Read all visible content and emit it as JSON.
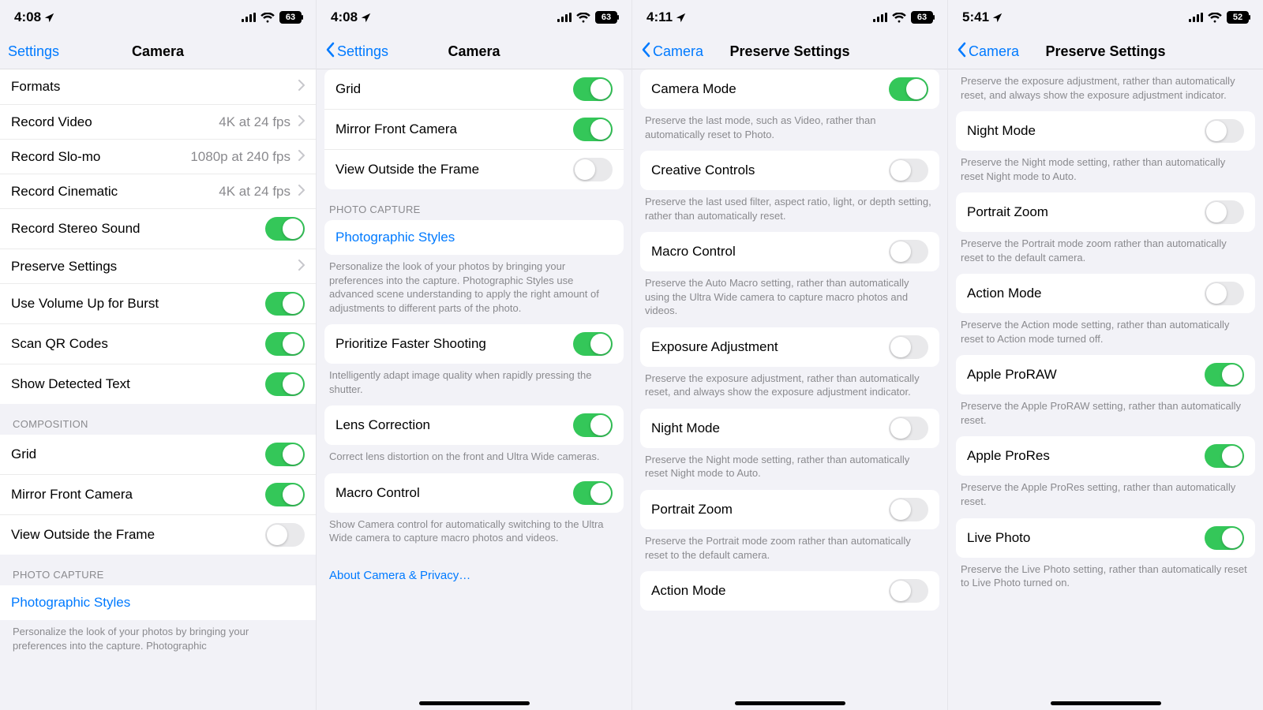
{
  "screens": [
    {
      "statusbar": {
        "time": "4:08",
        "battery": "63"
      },
      "nav": {
        "back": "Settings",
        "title": "Camera",
        "chevron": false
      },
      "footer_link": null,
      "home_indicator": false,
      "blocks": [
        {
          "type": "group",
          "flat": true,
          "rows": [
            {
              "label": "Formats",
              "kind": "nav"
            },
            {
              "label": "Record Video",
              "kind": "nav",
              "value": "4K at 24 fps"
            },
            {
              "label": "Record Slo-mo",
              "kind": "nav",
              "value": "1080p at 240 fps"
            },
            {
              "label": "Record Cinematic",
              "kind": "nav",
              "value": "4K at 24 fps"
            },
            {
              "label": "Record Stereo Sound",
              "kind": "toggle",
              "on": true
            },
            {
              "label": "Preserve Settings",
              "kind": "nav"
            },
            {
              "label": "Use Volume Up for Burst",
              "kind": "toggle",
              "on": true
            },
            {
              "label": "Scan QR Codes",
              "kind": "toggle",
              "on": true
            },
            {
              "label": "Show Detected Text",
              "kind": "toggle",
              "on": true
            }
          ]
        },
        {
          "type": "header",
          "text": "COMPOSITION"
        },
        {
          "type": "group",
          "flat": true,
          "rows": [
            {
              "label": "Grid",
              "kind": "toggle",
              "on": true
            },
            {
              "label": "Mirror Front Camera",
              "kind": "toggle",
              "on": true
            },
            {
              "label": "View Outside the Frame",
              "kind": "toggle",
              "on": false
            }
          ]
        },
        {
          "type": "header",
          "text": "PHOTO CAPTURE"
        },
        {
          "type": "group",
          "flat": true,
          "rows": [
            {
              "label": "Photographic Styles",
              "kind": "link"
            }
          ]
        },
        {
          "type": "footer",
          "text": "Personalize the look of your photos by bringing your preferences into the capture. Photographic"
        }
      ]
    },
    {
      "statusbar": {
        "time": "4:08",
        "battery": "63"
      },
      "nav": {
        "back": "Settings",
        "title": "Camera",
        "chevron": true
      },
      "footer_link": "About Camera & Privacy…",
      "home_indicator": true,
      "blocks": [
        {
          "type": "group",
          "rows": [
            {
              "label": "Grid",
              "kind": "toggle",
              "on": true
            },
            {
              "label": "Mirror Front Camera",
              "kind": "toggle",
              "on": true
            },
            {
              "label": "View Outside the Frame",
              "kind": "toggle",
              "on": false
            }
          ]
        },
        {
          "type": "header",
          "text": "PHOTO CAPTURE"
        },
        {
          "type": "group",
          "rows": [
            {
              "label": "Photographic Styles",
              "kind": "link"
            }
          ]
        },
        {
          "type": "footer",
          "text": "Personalize the look of your photos by bringing your preferences into the capture. Photographic Styles use advanced scene understanding to apply the right amount of adjustments to different parts of the photo."
        },
        {
          "type": "group",
          "rows": [
            {
              "label": "Prioritize Faster Shooting",
              "kind": "toggle",
              "on": true
            }
          ]
        },
        {
          "type": "footer",
          "text": "Intelligently adapt image quality when rapidly pressing the shutter."
        },
        {
          "type": "group",
          "rows": [
            {
              "label": "Lens Correction",
              "kind": "toggle",
              "on": true
            }
          ]
        },
        {
          "type": "footer",
          "text": "Correct lens distortion on the front and Ultra Wide cameras."
        },
        {
          "type": "group",
          "rows": [
            {
              "label": "Macro Control",
              "kind": "toggle",
              "on": true
            }
          ]
        },
        {
          "type": "footer",
          "text": "Show Camera control for automatically switching to the Ultra Wide camera to capture macro photos and videos."
        }
      ]
    },
    {
      "statusbar": {
        "time": "4:11",
        "battery": "63"
      },
      "nav": {
        "back": "Camera",
        "title": "Preserve Settings",
        "chevron": true
      },
      "footer_link": null,
      "home_indicator": true,
      "blocks": [
        {
          "type": "group",
          "rows": [
            {
              "label": "Camera Mode",
              "kind": "toggle",
              "on": true
            }
          ]
        },
        {
          "type": "footer",
          "text": "Preserve the last mode, such as Video, rather than automatically reset to Photo."
        },
        {
          "type": "group",
          "rows": [
            {
              "label": "Creative Controls",
              "kind": "toggle",
              "on": false
            }
          ]
        },
        {
          "type": "footer",
          "text": "Preserve the last used filter, aspect ratio, light, or depth setting, rather than automatically reset."
        },
        {
          "type": "group",
          "rows": [
            {
              "label": "Macro Control",
              "kind": "toggle",
              "on": false
            }
          ]
        },
        {
          "type": "footer",
          "text": "Preserve the Auto Macro setting, rather than automatically using the Ultra Wide camera to capture macro photos and videos."
        },
        {
          "type": "group",
          "rows": [
            {
              "label": "Exposure Adjustment",
              "kind": "toggle",
              "on": false
            }
          ]
        },
        {
          "type": "footer",
          "text": "Preserve the exposure adjustment, rather than automatically reset, and always show the exposure adjustment indicator."
        },
        {
          "type": "group",
          "rows": [
            {
              "label": "Night Mode",
              "kind": "toggle",
              "on": false
            }
          ]
        },
        {
          "type": "footer",
          "text": "Preserve the Night mode setting, rather than automatically reset Night mode to Auto."
        },
        {
          "type": "group",
          "rows": [
            {
              "label": "Portrait Zoom",
              "kind": "toggle",
              "on": false
            }
          ]
        },
        {
          "type": "footer",
          "text": "Preserve the Portrait mode zoom rather than automatically reset to the default camera."
        },
        {
          "type": "group",
          "rows": [
            {
              "label": "Action Mode",
              "kind": "toggle",
              "on": false
            }
          ]
        }
      ]
    },
    {
      "statusbar": {
        "time": "5:41",
        "battery": "52"
      },
      "nav": {
        "back": "Camera",
        "title": "Preserve Settings",
        "chevron": true
      },
      "footer_link": null,
      "home_indicator": true,
      "blocks": [
        {
          "type": "footer",
          "text": "Preserve the exposure adjustment, rather than automatically reset, and always show the exposure adjustment indicator."
        },
        {
          "type": "group",
          "rows": [
            {
              "label": "Night Mode",
              "kind": "toggle",
              "on": false
            }
          ]
        },
        {
          "type": "footer",
          "text": "Preserve the Night mode setting, rather than automatically reset Night mode to Auto."
        },
        {
          "type": "group",
          "rows": [
            {
              "label": "Portrait Zoom",
              "kind": "toggle",
              "on": false
            }
          ]
        },
        {
          "type": "footer",
          "text": "Preserve the Portrait mode zoom rather than automatically reset to the default camera."
        },
        {
          "type": "group",
          "rows": [
            {
              "label": "Action Mode",
              "kind": "toggle",
              "on": false
            }
          ]
        },
        {
          "type": "footer",
          "text": "Preserve the Action mode setting, rather than automatically reset to Action mode turned off."
        },
        {
          "type": "group",
          "rows": [
            {
              "label": "Apple ProRAW",
              "kind": "toggle",
              "on": true
            }
          ]
        },
        {
          "type": "footer",
          "text": "Preserve the Apple ProRAW setting, rather than automatically reset."
        },
        {
          "type": "group",
          "rows": [
            {
              "label": "Apple ProRes",
              "kind": "toggle",
              "on": true
            }
          ]
        },
        {
          "type": "footer",
          "text": "Preserve the Apple ProRes setting, rather than automatically reset."
        },
        {
          "type": "group",
          "rows": [
            {
              "label": "Live Photo",
              "kind": "toggle",
              "on": true
            }
          ]
        },
        {
          "type": "footer",
          "text": "Preserve the Live Photo setting, rather than automatically reset to Live Photo turned on."
        }
      ]
    }
  ]
}
